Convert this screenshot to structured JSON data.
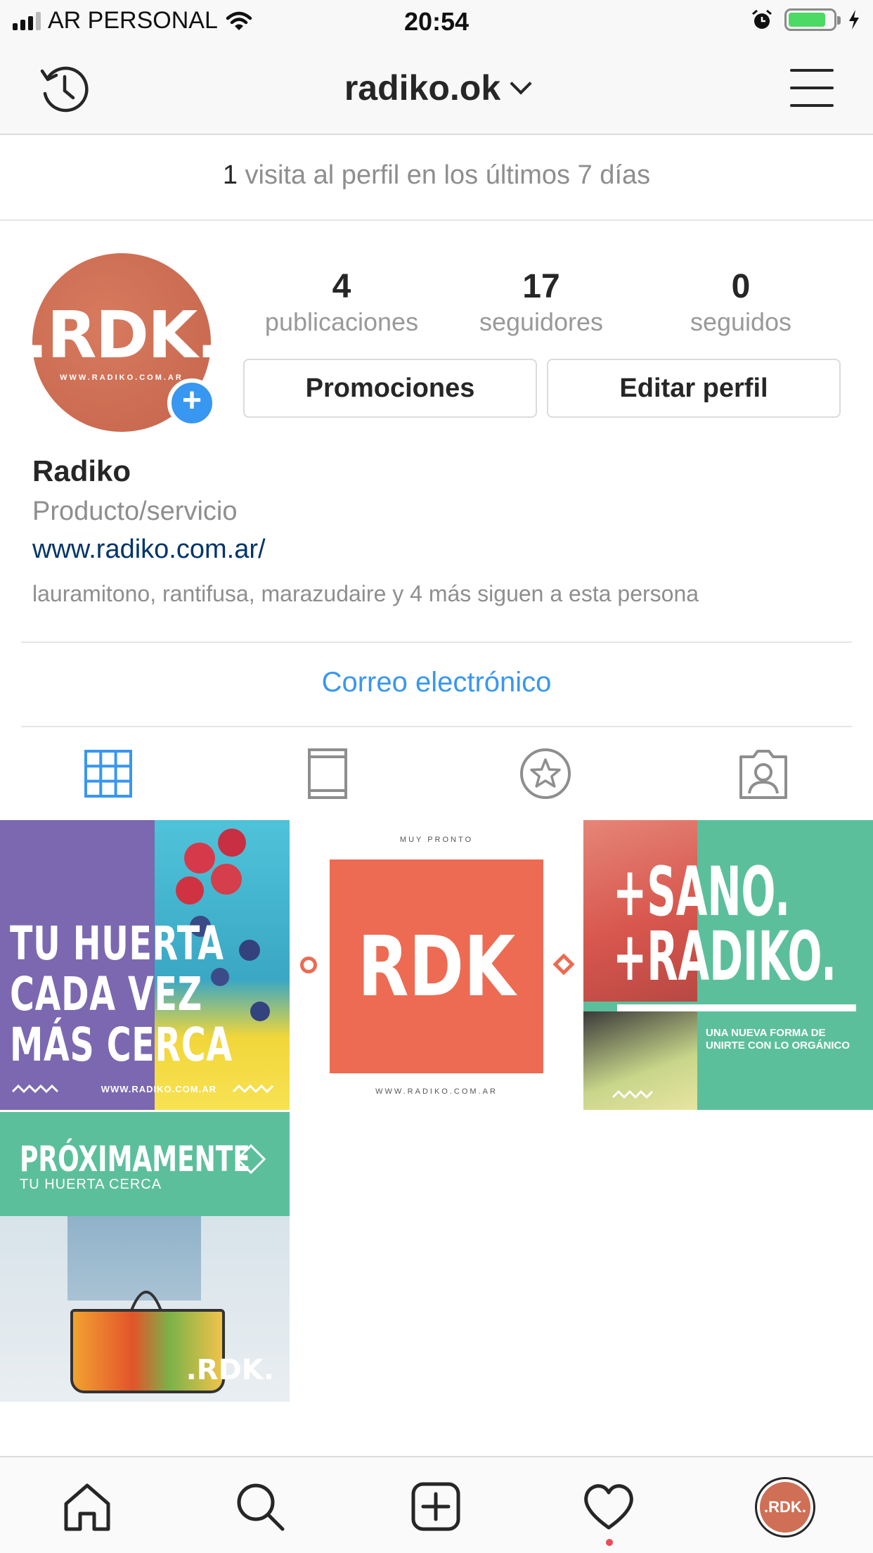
{
  "status_bar": {
    "carrier": "AR PERSONAL",
    "time": "20:54",
    "battery_color": "#4cd964"
  },
  "nav": {
    "username": "radiko.ok",
    "left_icon": "history-icon",
    "right_icon": "menu-icon"
  },
  "insights": {
    "count": "1",
    "text": " visita al perfil en los últimos 7 días"
  },
  "profile": {
    "avatar_text": ".RDK.",
    "avatar_sub": "WWW.RADIKO.COM.AR",
    "stats": [
      {
        "value": "4",
        "label": "publicaciones"
      },
      {
        "value": "17",
        "label": "seguidores"
      },
      {
        "value": "0",
        "label": "seguidos"
      }
    ],
    "buttons": {
      "promotions": "Promociones",
      "edit": "Editar perfil"
    },
    "name": "Radiko",
    "category": "Producto/servicio",
    "website": "www.radiko.com.ar/",
    "followed_by": "lauramitono, rantifusa, marazudaire y 4 más siguen a esta persona"
  },
  "contact": {
    "email_label": "Correo electrónico"
  },
  "tabs": [
    "grid-icon",
    "feed-icon",
    "saved-icon",
    "tagged-icon"
  ],
  "posts": [
    {
      "lines": [
        "TU HUERTA",
        "CADA VEZ",
        "MÁS CERCA"
      ],
      "url": "WWW.RADIKO.COM.AR"
    },
    {
      "top": "MUY PRONTO",
      "logo": "RDK",
      "url": "WWW.RADIKO.COM.AR"
    },
    {
      "lines": [
        "+SANO.",
        "+RADIKO."
      ],
      "tagline": "UNA NUEVA FORMA DE UNIRTE CON LO ORGÁNICO"
    },
    {
      "title": "PRÓXIMAMENTE",
      "subtitle": "TU HUERTA CERCA",
      "logo": ".RDK."
    }
  ],
  "bottom_nav": {
    "avatar_text": ".RDK."
  },
  "colors": {
    "accent": "#3897f0",
    "link": "#003569",
    "notification": "#ed4956"
  }
}
